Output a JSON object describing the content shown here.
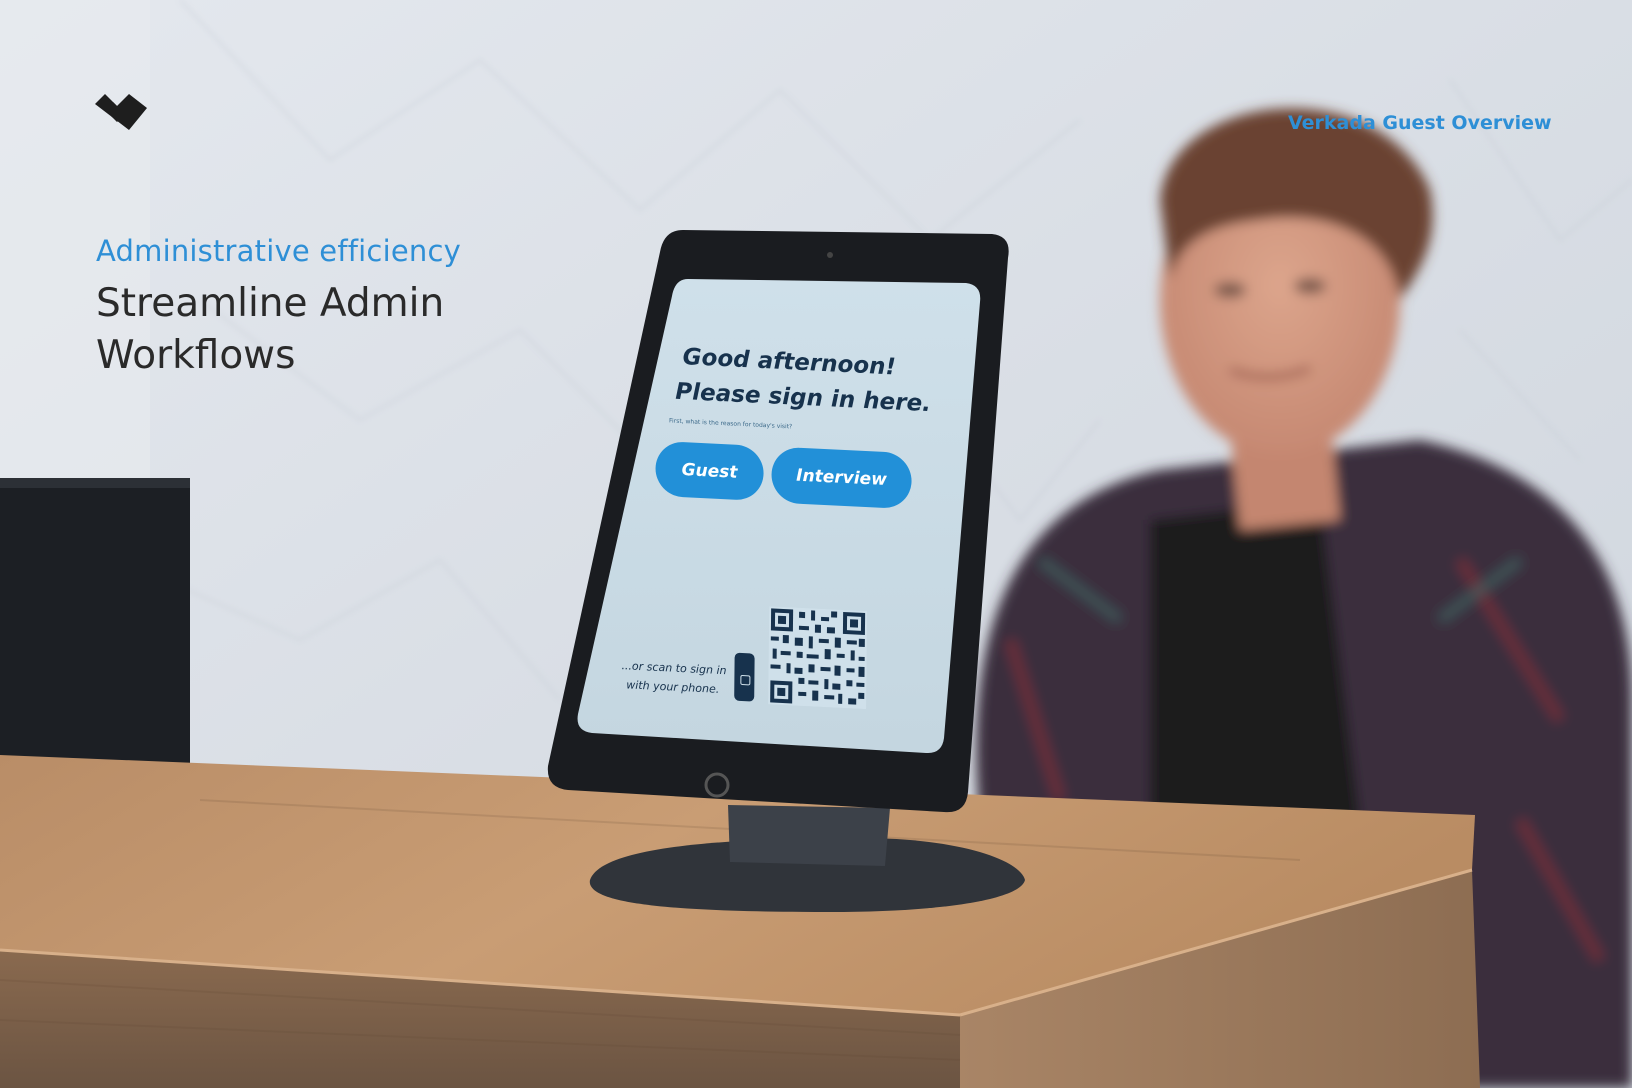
{
  "brand": {
    "logo_icon": "verkada-check-logo-icon",
    "accent_color": "#2e8fd6"
  },
  "header": {
    "document_title": "Verkada Guest Overview"
  },
  "hero": {
    "eyebrow": "Administrative efficiency",
    "title_line1": "Streamline Admin",
    "title_line2": "Workflows"
  },
  "kiosk": {
    "greeting_line1": "Good afternoon!",
    "greeting_line2": "Please sign in here.",
    "prompt": "First, what is the reason for today's visit?",
    "buttons": [
      {
        "label": "Guest"
      },
      {
        "label": "Interview"
      }
    ],
    "scan_line1": "...or scan to sign in",
    "scan_line2": "with your phone.",
    "phone_icon": "phone-icon",
    "qr_icon": "qr-code-icon"
  }
}
